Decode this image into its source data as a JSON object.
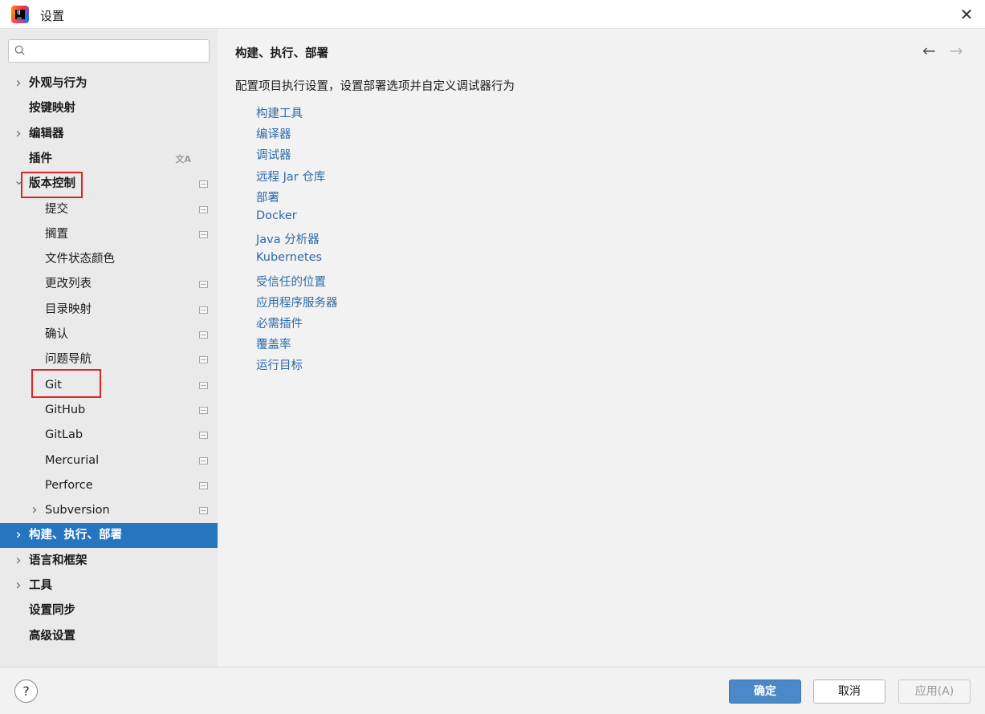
{
  "window": {
    "title": "设置"
  },
  "search": {
    "placeholder": "",
    "value": ""
  },
  "sidebar": {
    "items": [
      {
        "label": "外观与行为",
        "bold": true,
        "chevron": "right"
      },
      {
        "label": "按键映射",
        "bold": true,
        "chevron": "none"
      },
      {
        "label": "编辑器",
        "bold": true,
        "chevron": "right"
      },
      {
        "label": "插件",
        "bold": true,
        "chevron": "none",
        "icon": "translate-icon"
      },
      {
        "label": "版本控制",
        "bold": true,
        "chevron": "down",
        "icon": "project-scope-icon",
        "highlighted": true
      },
      {
        "label": "提交",
        "bold": false,
        "icon": "project-scope-icon"
      },
      {
        "label": "搁置",
        "bold": false,
        "icon": "project-scope-icon"
      },
      {
        "label": "文件状态颜色",
        "bold": false
      },
      {
        "label": "更改列表",
        "bold": false,
        "icon": "project-scope-icon"
      },
      {
        "label": "目录映射",
        "bold": false,
        "icon": "project-scope-icon"
      },
      {
        "label": "确认",
        "bold": false,
        "icon": "project-scope-icon"
      },
      {
        "label": "问题导航",
        "bold": false,
        "icon": "project-scope-icon"
      },
      {
        "label": "Git",
        "bold": false,
        "icon": "project-scope-icon",
        "highlighted": true
      },
      {
        "label": "GitHub",
        "bold": false,
        "icon": "project-scope-icon"
      },
      {
        "label": "GitLab",
        "bold": false,
        "icon": "project-scope-icon"
      },
      {
        "label": "Mercurial",
        "bold": false,
        "icon": "project-scope-icon"
      },
      {
        "label": "Perforce",
        "bold": false,
        "icon": "project-scope-icon"
      },
      {
        "label": "Subversion",
        "bold": false,
        "chevron": "right",
        "icon": "project-scope-icon"
      },
      {
        "label": "构建、执行、部署",
        "bold": true,
        "chevron": "right",
        "selected": true
      },
      {
        "label": "语言和框架",
        "bold": true,
        "chevron": "right"
      },
      {
        "label": "工具",
        "bold": true,
        "chevron": "right"
      },
      {
        "label": "设置同步",
        "bold": true,
        "chevron": "none"
      },
      {
        "label": "高级设置",
        "bold": true,
        "chevron": "none"
      }
    ]
  },
  "main": {
    "breadcrumb": "构建、执行、部署",
    "description": "配置项目执行设置，设置部署选项并自定义调试器行为",
    "links": [
      "构建工具",
      "编译器",
      "调试器",
      "远程 Jar 仓库",
      "部署",
      "Docker",
      "Java 分析器",
      "Kubernetes",
      "受信任的位置",
      "应用程序服务器",
      "必需插件",
      "覆盖率",
      "运行目标"
    ]
  },
  "footer": {
    "help": "?",
    "ok": "确定",
    "cancel": "取消",
    "apply": "应用(A)"
  },
  "colors": {
    "selected": "#2675bf",
    "link": "#2d6aa8",
    "ok_button": "#4a88c7",
    "highlight_box": "#e02424"
  }
}
